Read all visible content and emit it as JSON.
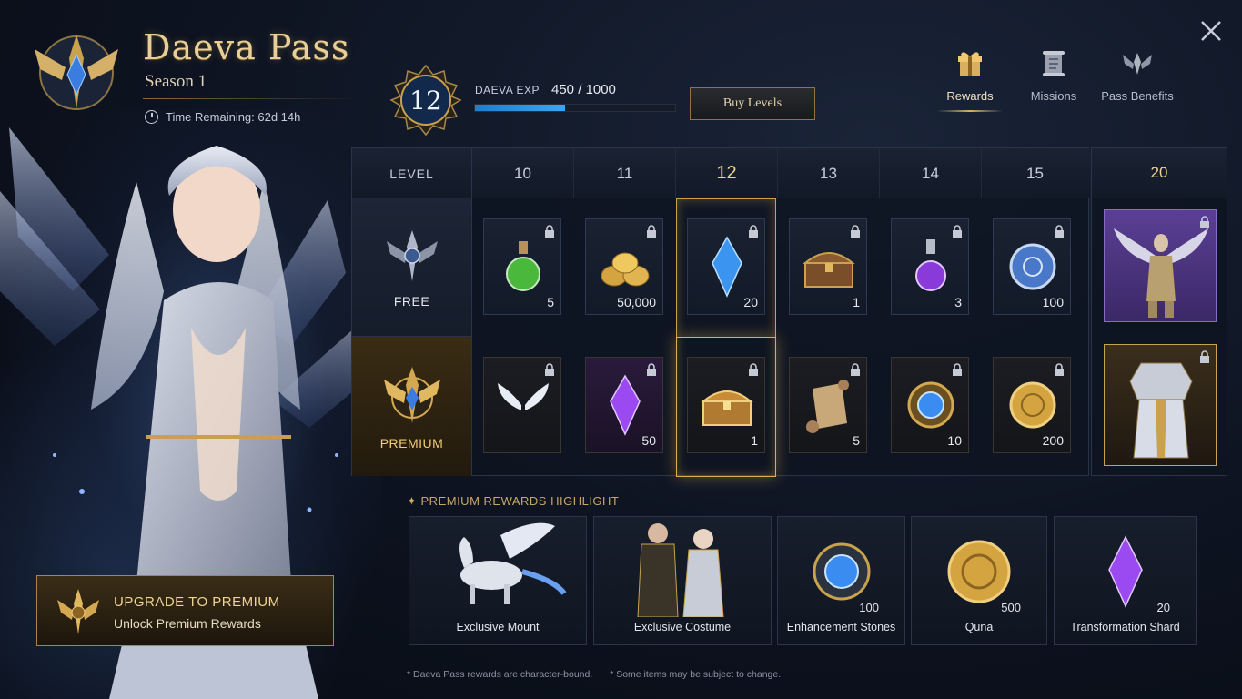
{
  "header": {
    "title": "Daeva Pass",
    "season": "Season 1",
    "time_remaining": "Time Remaining: 62d 14h"
  },
  "progress": {
    "level": "12",
    "exp_label": "DAEVA EXP",
    "exp_value": "450 / 1000",
    "exp_fraction": 0.45,
    "buy_label": "Buy Levels"
  },
  "nav": {
    "tabs": [
      {
        "label": "Rewards",
        "icon": "gift-icon",
        "active": true
      },
      {
        "label": "Missions",
        "icon": "scroll-icon",
        "active": false
      },
      {
        "label": "Pass Benefits",
        "icon": "wings-emblem-icon",
        "active": false
      }
    ]
  },
  "grid": {
    "level_label": "LEVEL",
    "levels": [
      "10",
      "11",
      "12",
      "13",
      "14",
      "15"
    ],
    "current_level": "12",
    "capstone_level": "20",
    "free_label": "FREE",
    "premium_label": "PREMIUM",
    "free_rewards": [
      {
        "item": "green-potion",
        "qty": "5"
      },
      {
        "item": "gold-coins",
        "qty": "50,000"
      },
      {
        "item": "blue-crystal",
        "qty": "20"
      },
      {
        "item": "treasure-chest",
        "qty": "1"
      },
      {
        "item": "purple-potion",
        "qty": "3"
      },
      {
        "item": "blue-coin",
        "qty": "100"
      }
    ],
    "premium_rewards": [
      {
        "item": "white-wings",
        "qty": ""
      },
      {
        "item": "purple-crystal",
        "qty": "50"
      },
      {
        "item": "golden-chest",
        "qty": "1"
      },
      {
        "item": "scroll",
        "qty": "5"
      },
      {
        "item": "blue-gem-medallion",
        "qty": "10"
      },
      {
        "item": "gold-coin",
        "qty": "200"
      }
    ],
    "capstone_free": "winged-armor-costume",
    "capstone_premium": "silver-armor-costume"
  },
  "highlight": {
    "title": "PREMIUM REWARDS HIGHLIGHT",
    "items": [
      {
        "name": "Exclusive Mount",
        "qty": ""
      },
      {
        "name": "Exclusive Costume",
        "qty": ""
      },
      {
        "name": "Enhancement Stones",
        "qty": "100"
      },
      {
        "name": "Quna",
        "qty": "500"
      },
      {
        "name": "Transformation Shard",
        "qty": "20"
      }
    ]
  },
  "upgrade": {
    "title": "UPGRADE TO PREMIUM",
    "subtitle": "Unlock Premium Rewards"
  },
  "footnotes": {
    "note1": "* Daeva Pass rewards are character-bound.",
    "note2": "* Some items may be subject to change."
  },
  "colors": {
    "gold_accent": "#d8b070",
    "exp_bar": "#2a94e0",
    "premium_bg": "#2e2210",
    "capstone_purple": "#5b3f94"
  }
}
